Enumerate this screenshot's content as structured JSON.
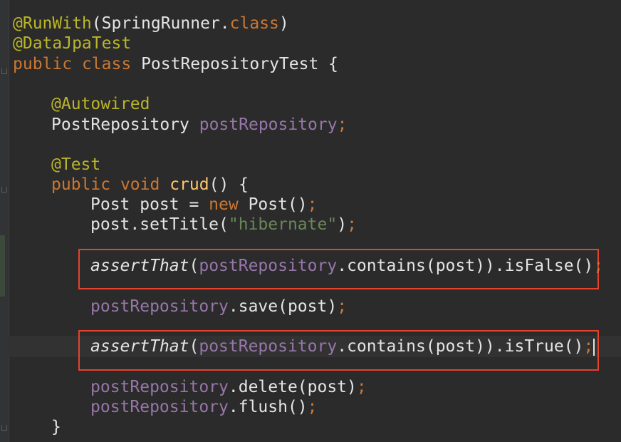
{
  "editor": {
    "line_1": {
      "annotation": "@RunWith",
      "p1": "(SpringRunner.",
      "kw": "class",
      "p2": ")"
    },
    "line_2": {
      "annotation": "@DataJpaTest"
    },
    "line_3": {
      "kw1": "public",
      "kw2": "class",
      "name": "PostRepositoryTest",
      "brace": "{"
    },
    "line_5": {
      "annotation": "@Autowired"
    },
    "line_6": {
      "type": "PostRepository",
      "field": "postRepository",
      "semi": ";"
    },
    "line_8": {
      "annotation": "@Test"
    },
    "line_9": {
      "kw1": "public",
      "kw2": "void",
      "method": "crud",
      "rest": "() {"
    },
    "line_10": {
      "p1": "Post post = ",
      "kw": "new",
      "p2": " Post()",
      "semi": ";"
    },
    "line_11": {
      "p1": "post.setTitle(",
      "str": "\"hibernate\"",
      "p2": ")",
      "semi": ";"
    },
    "line_13": {
      "method": "assertThat",
      "p1": "(",
      "field": "postRepository",
      "p2": ".contains(post)).isFalse()",
      "semi": ";"
    },
    "line_15": {
      "field": "postRepository",
      "p1": ".save(post)",
      "semi": ";"
    },
    "line_17": {
      "method": "assertThat",
      "p1": "(",
      "field": "postRepository",
      "p2": ".contains(post)).isTrue()",
      "semi": ";"
    },
    "line_19": {
      "field": "postRepository",
      "p1": ".delete(post)",
      "semi": ";"
    },
    "line_20": {
      "field": "postRepository",
      "p1": ".flush()",
      "semi": ";"
    },
    "line_21": {
      "brace": "}"
    }
  },
  "colors": {
    "background": "#2b2b2b",
    "annotation": "#bbb529",
    "keyword": "#cc7832",
    "field": "#9876aa",
    "string": "#6a8759",
    "highlight_box": "#e8412c"
  }
}
